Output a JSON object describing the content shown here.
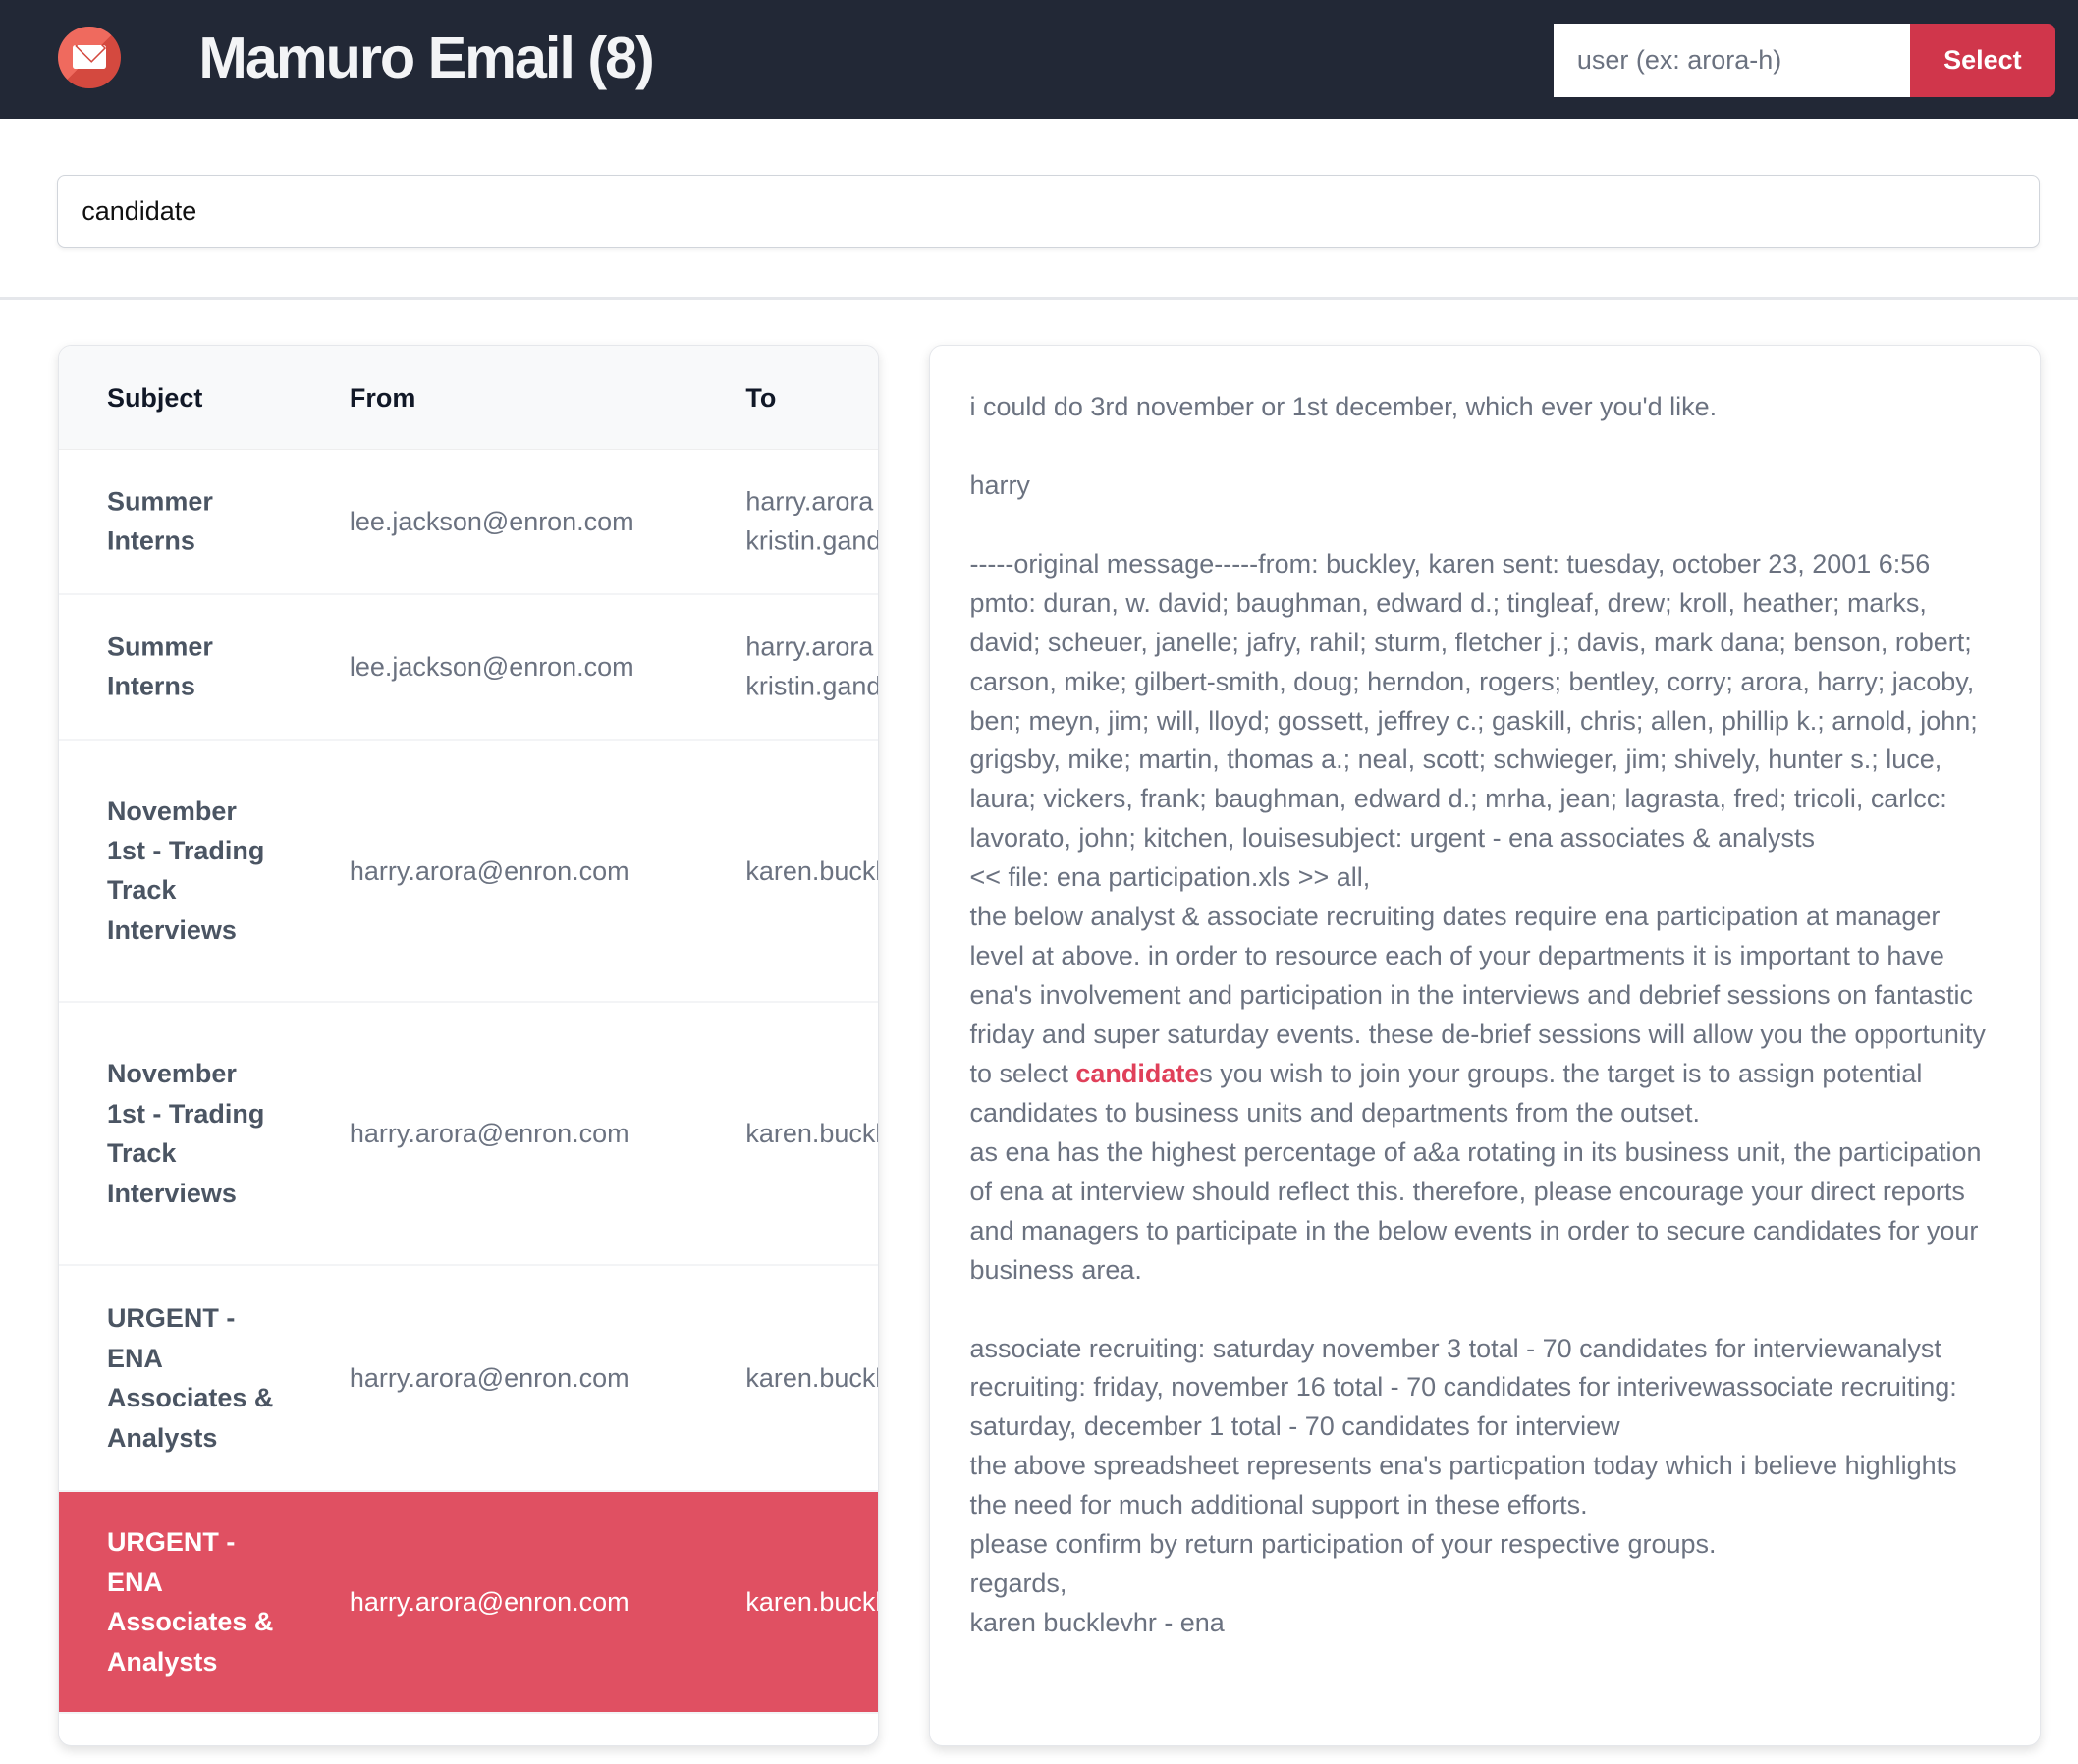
{
  "header": {
    "title": "Mamuro Email (8)",
    "logo_icon": "envelope-icon",
    "user_placeholder": "user (ex: arora-h)",
    "select_label": "Select"
  },
  "search": {
    "value": "candidate"
  },
  "table": {
    "columns": [
      "Subject",
      "From",
      "To"
    ],
    "rows": [
      {
        "subject": "Summer Interns",
        "from": "lee.jackson@enron.com",
        "to": "harry.arora\nkristin.gandy"
      },
      {
        "subject": "Summer Interns",
        "from": "lee.jackson@enron.com",
        "to": "harry.arora\nkristin.gandy"
      },
      {
        "subject": "November 1st - Trading Track Interviews",
        "from": "harry.arora@enron.com",
        "to": "karen.buckley"
      },
      {
        "subject": "November 1st - Trading Track Interviews",
        "from": "harry.arora@enron.com",
        "to": "karen.buckley"
      },
      {
        "subject": "URGENT - ENA Associates & Analysts",
        "from": "harry.arora@enron.com",
        "to": "karen.buckley"
      },
      {
        "subject": "URGENT - ENA Associates & Analysts",
        "from": "harry.arora@enron.com",
        "to": "karen.buckley",
        "selected": true
      }
    ]
  },
  "email": {
    "before": "i could do 3rd november or 1st december, which ever you'd like.\n\nharry\n\n-----original message-----from: buckley, karen sent: tuesday, october 23, 2001 6:56 pmto: duran, w. david; baughman, edward d.; tingleaf, drew; kroll, heather; marks, david; scheuer, janelle; jafry, rahil; sturm, fletcher j.; davis, mark dana; benson, robert; carson, mike; gilbert-smith, doug; herndon, rogers; bentley, corry; arora, harry; jacoby, ben; meyn, jim; will, lloyd; gossett, jeffrey c.; gaskill, chris; allen, phillip k.; arnold, john; grigsby, mike; martin, thomas a.; neal, scott; schwieger, jim; shively, hunter s.; luce, laura; vickers, frank; baughman, edward d.; mrha, jean; lagrasta, fred; tricoli, carlcc: lavorato, john; kitchen, louisesubject: urgent - ena associates & analysts\n<< file: ena participation.xls >> all,\nthe below analyst & associate recruiting dates require ena participation at manager level at above. in order to resource each of your departments it is important to have ena's involvement and participation in the interviews and debrief sessions on fantastic friday and super saturday events. these de-brief sessions will allow you the opportunity to select ",
    "highlight": "candidate",
    "after": "s you wish to join your groups. the target is to assign potential candidates to business units and departments from the outset.\nas ena has the highest percentage of a&a rotating in its business unit, the participation of ena at interview should reflect this. therefore, please encourage your direct reports and managers to participate in the below events in order to secure candidates for your business area.\n\nassociate recruiting: saturday november 3 total - 70 candidates for interviewanalyst recruiting: friday, november 16 total - 70 candidates for interivewassociate recruiting: saturday, december 1 total - 70 candidates for interview\nthe above spreadsheet represents ena's particpation today which i believe highlights the need for much additional support in these efforts.\nplease confirm by return participation of your respective groups.\nregards,\nkaren bucklevhr - ena"
  }
}
